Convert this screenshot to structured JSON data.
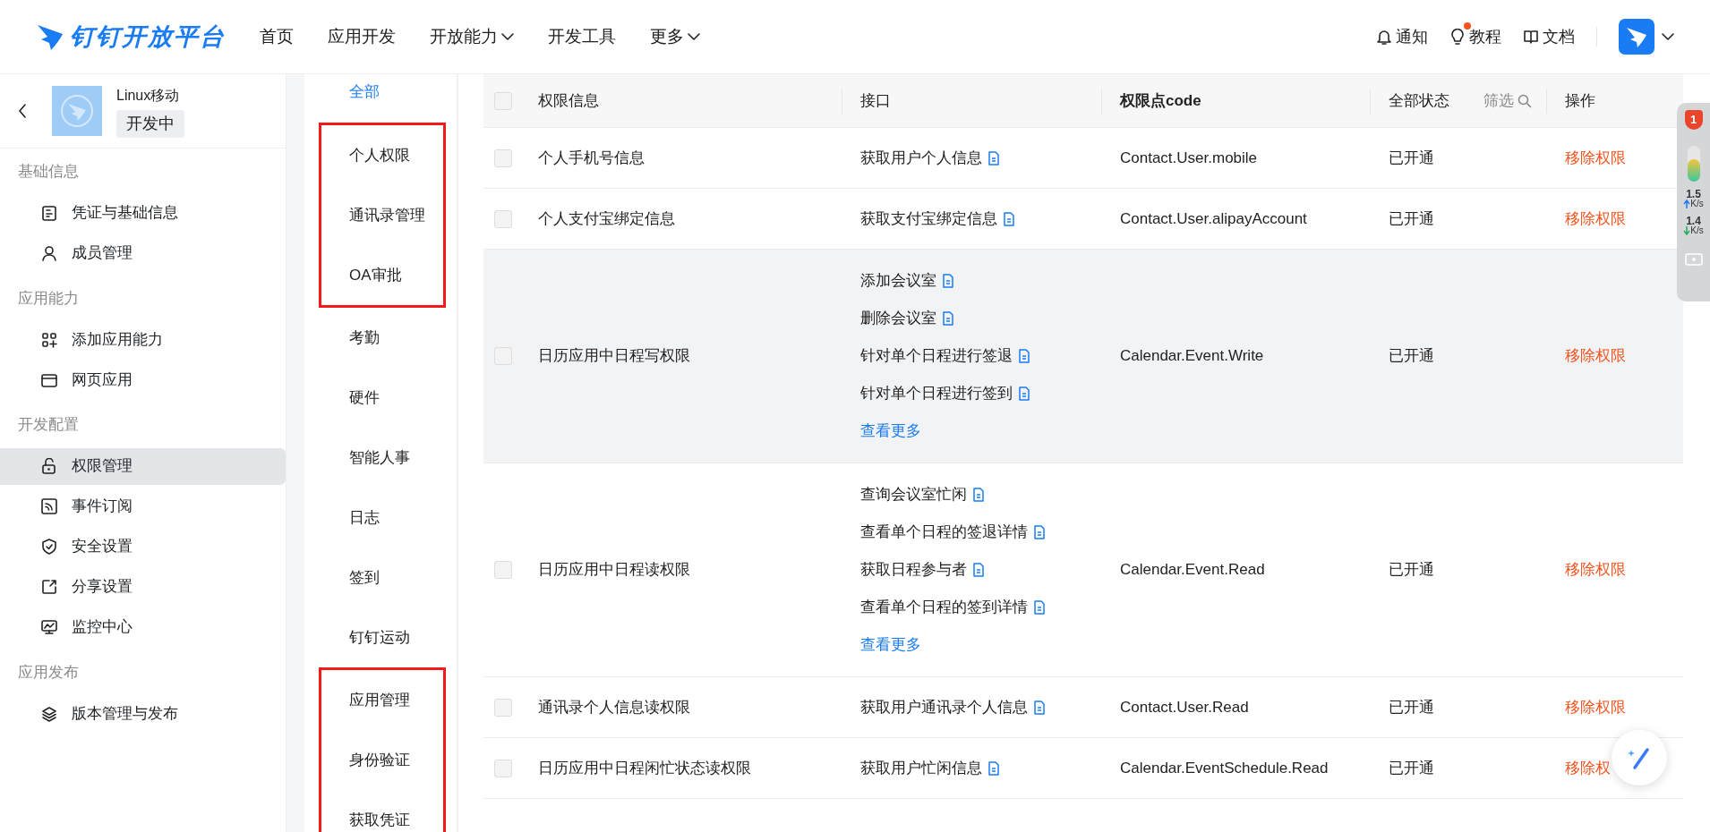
{
  "navbar": {
    "logo_text": "钉钉开放平台",
    "menu": [
      {
        "label": "首页",
        "dropdown": false
      },
      {
        "label": "应用开发",
        "dropdown": false
      },
      {
        "label": "开放能力",
        "dropdown": true
      },
      {
        "label": "开发工具",
        "dropdown": false
      },
      {
        "label": "更多",
        "dropdown": true
      }
    ],
    "actions": [
      {
        "label": "通知",
        "dot": false
      },
      {
        "label": "教程",
        "dot": true
      },
      {
        "label": "文档",
        "dot": false
      }
    ]
  },
  "sidebar": {
    "app_name": "Linux移动",
    "app_status": "开发中",
    "sections": [
      {
        "title": "基础信息",
        "items": [
          {
            "label": "凭证与基础信息",
            "selected": false
          },
          {
            "label": "成员管理",
            "selected": false
          }
        ]
      },
      {
        "title": "应用能力",
        "items": [
          {
            "label": "添加应用能力",
            "selected": false
          },
          {
            "label": "网页应用",
            "selected": false
          }
        ]
      },
      {
        "title": "开发配置",
        "items": [
          {
            "label": "权限管理",
            "selected": true
          },
          {
            "label": "事件订阅",
            "selected": false
          },
          {
            "label": "安全设置",
            "selected": false
          },
          {
            "label": "分享设置",
            "selected": false
          },
          {
            "label": "监控中心",
            "selected": false
          }
        ]
      },
      {
        "title": "应用发布",
        "items": [
          {
            "label": "版本管理与发布",
            "selected": false
          }
        ]
      }
    ]
  },
  "categories": [
    {
      "label": "全部",
      "selected": true,
      "highlighted": false
    },
    {
      "label": "个人权限",
      "selected": false,
      "highlighted": true
    },
    {
      "label": "通讯录管理",
      "selected": false,
      "highlighted": true
    },
    {
      "label": "OA审批",
      "selected": false,
      "highlighted": true
    },
    {
      "label": "考勤",
      "selected": false,
      "highlighted": false
    },
    {
      "label": "硬件",
      "selected": false,
      "highlighted": false
    },
    {
      "label": "智能人事",
      "selected": false,
      "highlighted": false
    },
    {
      "label": "日志",
      "selected": false,
      "highlighted": false
    },
    {
      "label": "签到",
      "selected": false,
      "highlighted": false
    },
    {
      "label": "钉钉运动",
      "selected": false,
      "highlighted": false
    },
    {
      "label": "应用管理",
      "selected": false,
      "highlighted": true
    },
    {
      "label": "身份验证",
      "selected": false,
      "highlighted": true
    },
    {
      "label": "获取凭证",
      "selected": false,
      "highlighted": true
    }
  ],
  "table": {
    "header_checked": false,
    "columns": [
      "权限信息",
      "接口",
      "权限点code",
      "全部状态",
      "操作"
    ],
    "filter_label": "筛选",
    "rows": [
      {
        "checked": false,
        "hovered": false,
        "name": "个人手机号信息",
        "interfaces": [
          "获取用户个人信息"
        ],
        "code": "Contact.User.mobile",
        "status": "已开通",
        "action": "移除权限"
      },
      {
        "checked": false,
        "hovered": false,
        "name": "个人支付宝绑定信息",
        "interfaces": [
          "获取支付宝绑定信息"
        ],
        "code": "Contact.User.alipayAccount",
        "status": "已开通",
        "action": "移除权限"
      },
      {
        "checked": false,
        "hovered": true,
        "name": "日历应用中日程写权限",
        "interfaces": [
          "添加会议室",
          "删除会议室",
          "针对单个日程进行签退",
          "针对单个日程进行签到"
        ],
        "more_link": "查看更多",
        "code": "Calendar.Event.Write",
        "status": "已开通",
        "action": "移除权限"
      },
      {
        "checked": false,
        "hovered": false,
        "name": "日历应用中日程读权限",
        "interfaces": [
          "查询会议室忙闲",
          "查看单个日程的签退详情",
          "获取日程参与者",
          "查看单个日程的签到详情"
        ],
        "more_link": "查看更多",
        "code": "Calendar.Event.Read",
        "status": "已开通",
        "action": "移除权限"
      },
      {
        "checked": false,
        "hovered": false,
        "name": "通讯录个人信息读权限",
        "interfaces": [
          "获取用户通讯录个人信息"
        ],
        "code": "Contact.User.Read",
        "status": "已开通",
        "action": "移除权限"
      },
      {
        "checked": false,
        "hovered": false,
        "name": "日历应用中日程闲忙状态读权限",
        "interfaces": [
          "获取用户忙闲信息"
        ],
        "code": "Calendar.EventSchedule.Read",
        "status": "已开通",
        "action": "移除权"
      }
    ]
  },
  "overlay_widget": {
    "badge": "1",
    "upload": "1.5",
    "upload_unit": "K/s",
    "download": "1.4",
    "download_unit": "K/s"
  }
}
